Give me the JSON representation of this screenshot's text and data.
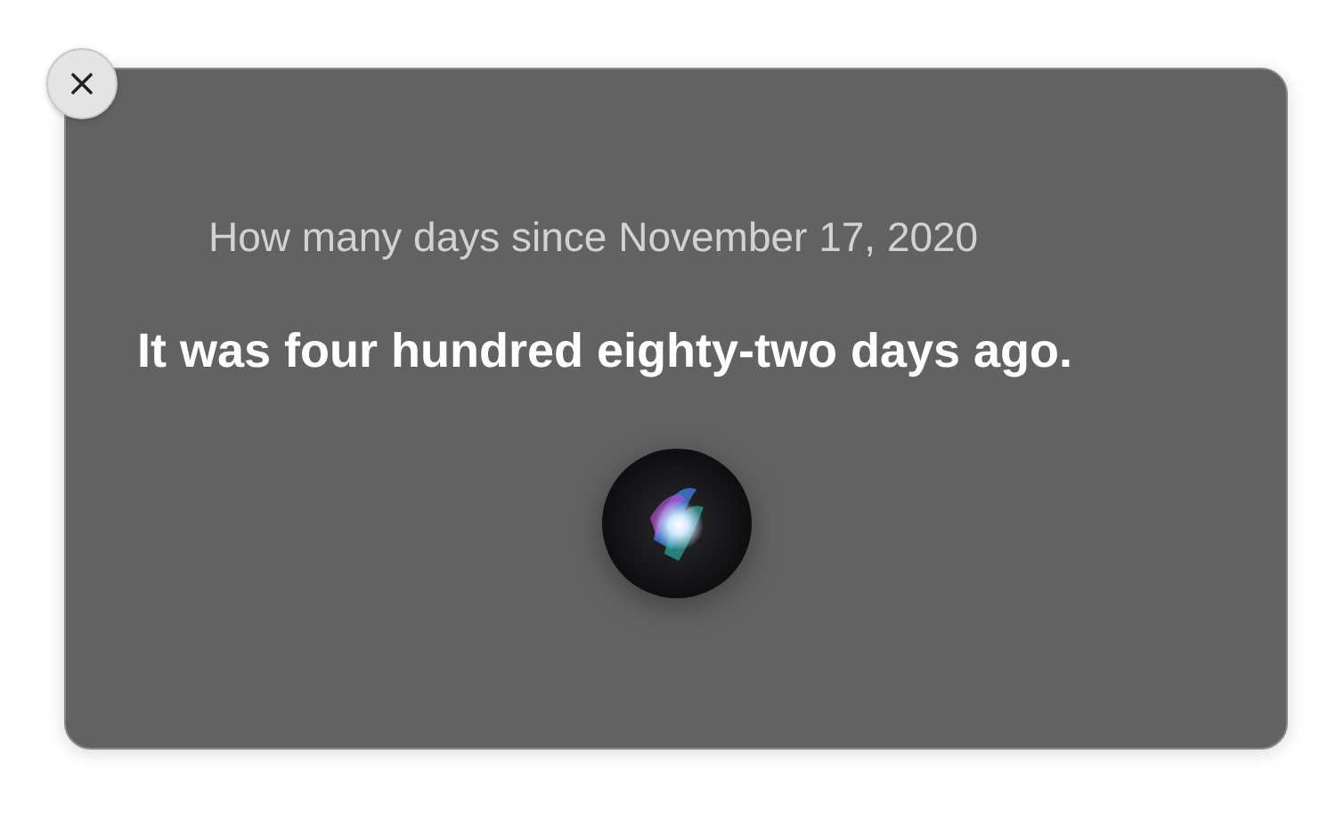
{
  "query": "How many days since November 17, 2020",
  "answer": "It was four hundred eighty-two days ago."
}
